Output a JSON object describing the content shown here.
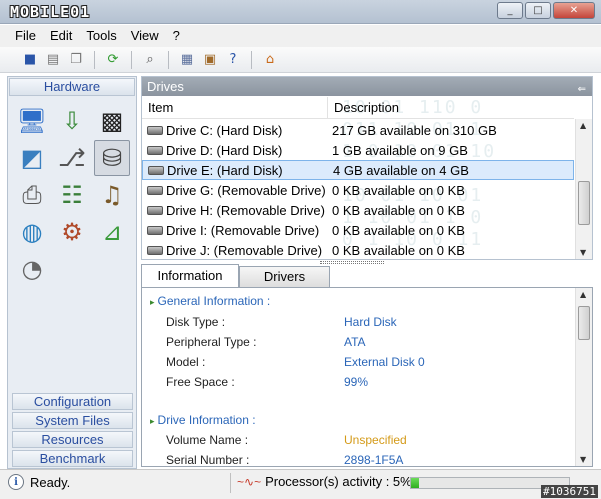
{
  "app": {
    "logo": "MOBILE01",
    "window_buttons": [
      "_",
      "□",
      "✕"
    ]
  },
  "menu": [
    "File",
    "Edit",
    "Tools",
    "View",
    "?"
  ],
  "toolbar": {
    "icons": [
      "save-icon",
      "print-icon",
      "copy-icon",
      "refresh-icon",
      "search-icon",
      "report-icon",
      "export-icon",
      "help-icon",
      "home-icon"
    ]
  },
  "sidebar": {
    "header": "Hardware",
    "icons": [
      "monitor-icon",
      "install-icon",
      "chip-icon",
      "display-settings-icon",
      "usb-icon",
      "drive-icon",
      "printer-icon",
      "network-icon",
      "audio-icon",
      "globe-icon",
      "devices-icon",
      "power-icon",
      "gauge-icon"
    ],
    "bottom": [
      "Configuration",
      "System Files",
      "Resources",
      "Benchmark"
    ]
  },
  "drives": {
    "title": "Drives",
    "columns": [
      "Item",
      "Description"
    ],
    "rows": [
      {
        "item": "Drive C: (Hard Disk)",
        "desc": "217 GB available on 310 GB"
      },
      {
        "item": "Drive D: (Hard Disk)",
        "desc": "1 GB available on 9 GB"
      },
      {
        "item": "Drive E: (Hard Disk)",
        "desc": "4 GB available on 4 GB",
        "selected": true
      },
      {
        "item": "Drive G: (Removable Drive)",
        "desc": "0 KB available on 0 KB"
      },
      {
        "item": "Drive H: (Removable Drive)",
        "desc": "0 KB available on 0 KB"
      },
      {
        "item": "Drive I: (Removable Drive)",
        "desc": "0 KB available on 0 KB"
      },
      {
        "item": "Drive J: (Removable Drive)",
        "desc": "0 KB available on 0 KB"
      }
    ]
  },
  "tabs": [
    "Information",
    "Drivers"
  ],
  "info": {
    "section1": "General Information :",
    "props1": [
      {
        "label": "Disk Type :",
        "value": "Hard Disk"
      },
      {
        "label": "Peripheral Type :",
        "value": "ATA"
      },
      {
        "label": "Model :",
        "value": "External Disk 0"
      },
      {
        "label": "Free Space :",
        "value": "99%"
      }
    ],
    "section2": "Drive Information :",
    "props2": [
      {
        "label": "Volume Name :",
        "value": "Unspecified"
      },
      {
        "label": "Serial Number :",
        "value": "2898-1F5A"
      }
    ]
  },
  "status": {
    "left": "Ready.",
    "processor": "Processor(s) activity : 5%",
    "progress": 0.05,
    "watermark": "#1036751"
  },
  "colors": {
    "link": "#2b66b8",
    "warning": "#d49a18",
    "selection": "#dcebfc"
  }
}
